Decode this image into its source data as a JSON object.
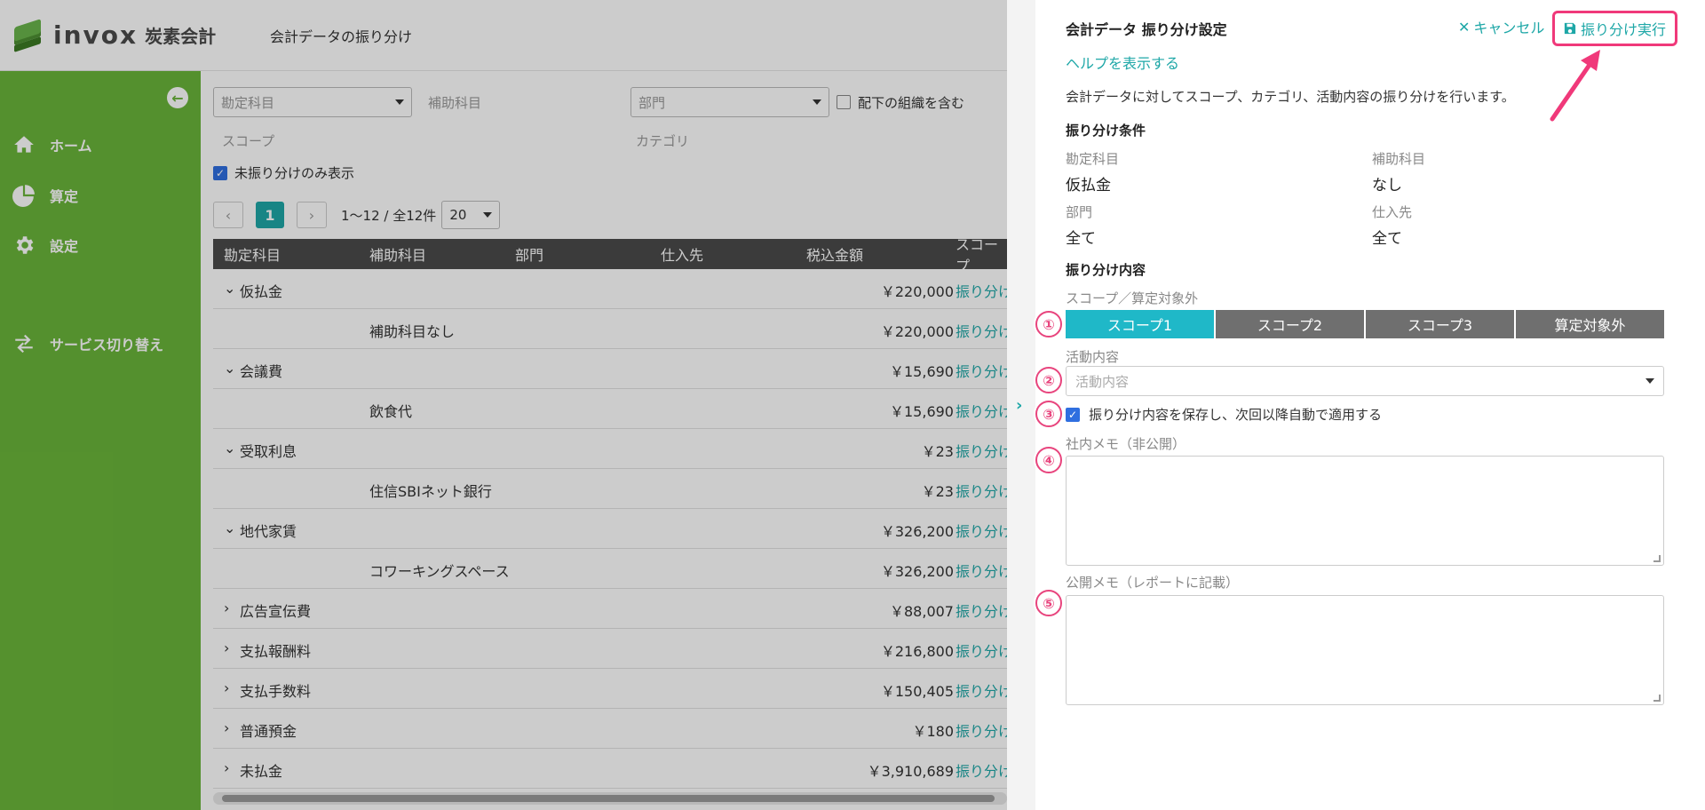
{
  "app": {
    "logo_text": "invox",
    "logo_sub": "炭素会計",
    "page_title": "会計データの振り分け"
  },
  "sidebar": {
    "items": [
      {
        "label": "ホーム",
        "icon": "home-icon"
      },
      {
        "label": "算定",
        "icon": "pie-chart-icon"
      },
      {
        "label": "設定",
        "icon": "gear-icon"
      },
      {
        "label": "サービス切り替え",
        "icon": "switch-icon"
      }
    ]
  },
  "filters": {
    "account_placeholder": "勘定科目",
    "sub_account_label": "補助科目",
    "department_placeholder": "部門",
    "include_sub_org": "配下の組織を含む",
    "scope_label": "スコープ",
    "category_label": "カテゴリ",
    "unassigned_only": "未振り分けのみ表示"
  },
  "pager": {
    "current_page": "1",
    "range_text": "1〜12 / 全12件",
    "page_size": "20"
  },
  "table": {
    "headers": [
      "勘定科目",
      "補助科目",
      "部門",
      "仕入先",
      "税込金額",
      "スコープ"
    ],
    "rows": [
      {
        "expand": "⌄",
        "account": "仮払金",
        "sub": "",
        "amount": "￥220,000",
        "action": "振り分け"
      },
      {
        "expand": "",
        "account": "",
        "sub": "補助科目なし",
        "amount": "￥220,000",
        "action": "振り分け"
      },
      {
        "expand": "⌄",
        "account": "会議費",
        "sub": "",
        "amount": "￥15,690",
        "action": "振り分け"
      },
      {
        "expand": "",
        "account": "",
        "sub": "飲食代",
        "amount": "￥15,690",
        "action": "振り分け"
      },
      {
        "expand": "⌄",
        "account": "受取利息",
        "sub": "",
        "amount": "￥23",
        "action": "振り分け"
      },
      {
        "expand": "",
        "account": "",
        "sub": "住信SBIネット銀行",
        "amount": "￥23",
        "action": "振り分け"
      },
      {
        "expand": "⌄",
        "account": "地代家賃",
        "sub": "",
        "amount": "￥326,200",
        "action": "振り分け"
      },
      {
        "expand": "",
        "account": "",
        "sub": "コワーキングスペース",
        "amount": "￥326,200",
        "action": "振り分け"
      },
      {
        "expand": "›",
        "account": "広告宣伝費",
        "sub": "",
        "amount": "￥88,007",
        "action": "振り分け"
      },
      {
        "expand": "›",
        "account": "支払報酬料",
        "sub": "",
        "amount": "￥216,800",
        "action": "振り分け"
      },
      {
        "expand": "›",
        "account": "支払手数料",
        "sub": "",
        "amount": "￥150,405",
        "action": "振り分け"
      },
      {
        "expand": "›",
        "account": "普通預金",
        "sub": "",
        "amount": "￥180",
        "action": "振り分け"
      },
      {
        "expand": "›",
        "account": "未払金",
        "sub": "",
        "amount": "￥3,910,689",
        "action": "振り分け"
      }
    ]
  },
  "drawer": {
    "title": "会計データ 振り分け設定",
    "cancel": "キャンセル",
    "execute": "振り分け実行",
    "help": "ヘルプを表示する",
    "description": "会計データに対してスコープ、カテゴリ、活動内容の振り分けを行います。",
    "conditions_heading": "振り分け条件",
    "account_label": "勘定科目",
    "account_value": "仮払金",
    "sub_account_label": "補助科目",
    "sub_account_value": "なし",
    "department_label": "部門",
    "department_value": "全て",
    "supplier_label": "仕入先",
    "supplier_value": "全て",
    "content_heading": "振り分け内容",
    "scope_label": "スコープ／算定対象外",
    "scope_options": [
      "スコープ1",
      "スコープ2",
      "スコープ3",
      "算定対象外"
    ],
    "selected_scope": "スコープ1",
    "activity_label": "活動内容",
    "activity_placeholder": "活動内容",
    "save_rule": "振り分け内容を保存し、次回以降自動で適用する",
    "internal_memo_label": "社内メモ（非公開）",
    "public_memo_label": "公開メモ（レポートに記載）",
    "badges": [
      "①",
      "②",
      "③",
      "④",
      "⑤"
    ]
  },
  "colors": {
    "sidebar": "#6ab53a",
    "accent": "#1ea7a7",
    "scope_selected": "#1fb8c8",
    "highlight": "#f0397a"
  }
}
